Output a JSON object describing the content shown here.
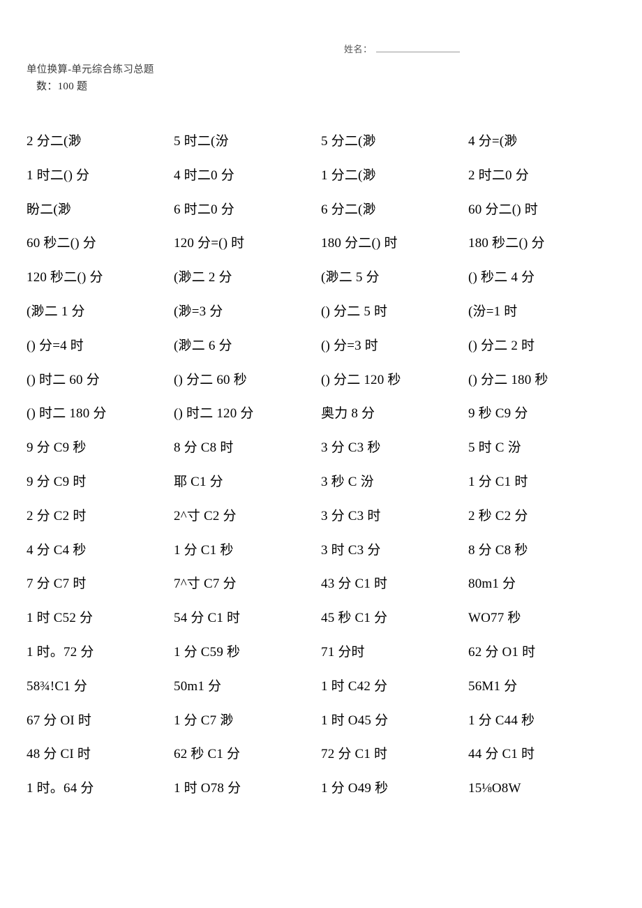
{
  "header": {
    "name_label": "姓名：",
    "name_blank_value": "",
    "title_line1": "单位换算-单元综合练习总题",
    "title_line2": "数：100 题"
  },
  "worksheet": {
    "columns": 4,
    "rows": [
      [
        "2 分二(渺",
        "5 时二(汾",
        "5 分二(渺",
        "4 分=(渺"
      ],
      [
        "1 时二() 分",
        "4 时二0 分",
        "1 分二(渺",
        "2 时二0 分"
      ],
      [
        "盼二(渺",
        "6 时二0 分",
        "6 分二(渺",
        "60 分二() 时"
      ],
      [
        "60 秒二() 分",
        "120 分=() 时",
        "180 分二() 时",
        "180 秒二() 分"
      ],
      [
        "120 秒二() 分",
        "(渺二 2 分",
        "(渺二 5 分",
        "() 秒二 4 分"
      ],
      [
        "(渺二 1 分",
        "(渺=3 分",
        "() 分二 5 时",
        "(汾=1 时"
      ],
      [
        "() 分=4 时",
        "(渺二 6 分",
        "() 分=3 时",
        "() 分二 2 时"
      ],
      [
        "() 时二 60 分",
        "() 分二 60 秒",
        "() 分二 120 秒",
        "() 分二 180 秒"
      ],
      [
        "() 时二 180 分",
        "() 时二 120 分",
        "奥力 8 分",
        "9 秒 C9 分"
      ],
      [
        "9 分 C9 秒",
        "8 分 C8 时",
        "3 分 C3 秒",
        "5 时 C 汾"
      ],
      [
        "9 分 C9 时",
        "耶 C1 分",
        "3 秒 C 汾",
        "1 分 C1 时"
      ],
      [
        "2 分 C2 时",
        "2^寸 C2 分",
        "3 分 C3 时",
        "2 秒 C2 分"
      ],
      [
        "4 分 C4 秒",
        "1 分 C1 秒",
        "3 时 C3 分",
        "8 分 C8 秒"
      ],
      [
        "7 分 C7 时",
        "7^寸 C7 分",
        "43 分 C1 时",
        "80m1 分"
      ],
      [
        "1 时 C52 分",
        "54 分 C1 时",
        "45 秒 C1 分",
        "WO77 秒"
      ],
      [
        "1 时。72 分",
        "1 分 C59 秒",
        "71 分时",
        "62 分 O1 时"
      ],
      [
        "58¾!C1 分",
        "50m1 分",
        "1 时 C42 分",
        "56M1 分"
      ],
      [
        "67 分 OI 时",
        "1 分 C7 渺",
        "1 时 O45 分",
        "1 分 C44 秒"
      ],
      [
        "48 分 CI 时",
        "62 秒 C1 分",
        "72 分 C1 时",
        "44 分 C1 时"
      ],
      [
        "1 时。64 分",
        "1 时 O78 分",
        "1 分 O49 秒",
        "15⅛O8W"
      ]
    ]
  }
}
